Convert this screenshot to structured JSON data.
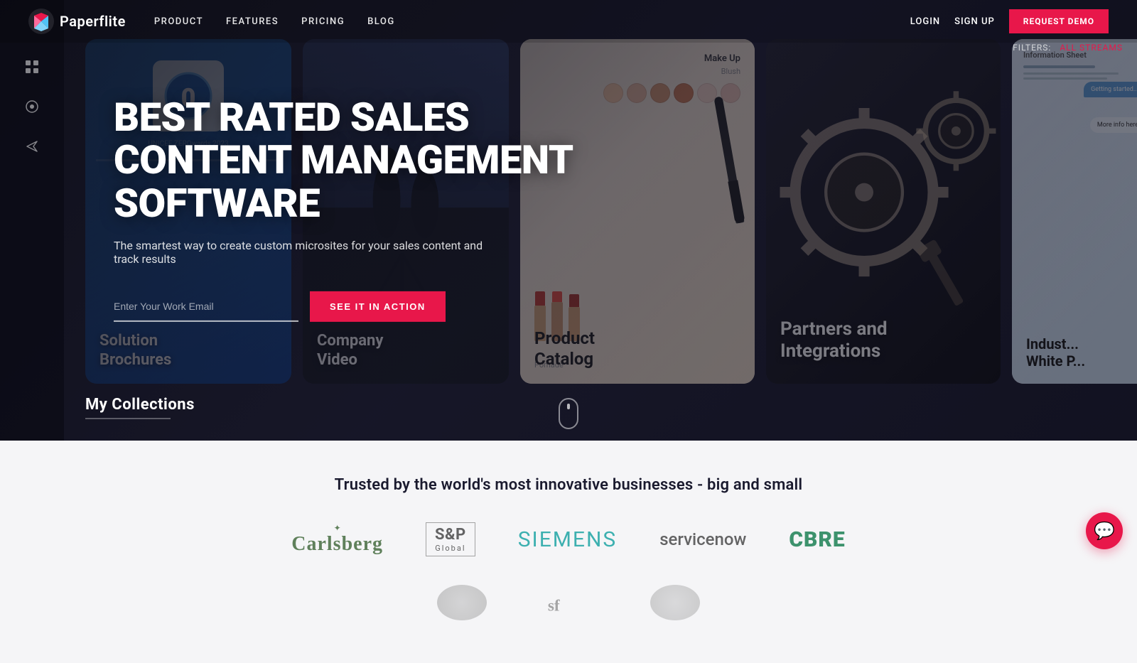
{
  "nav": {
    "logo_text": "Paperflite",
    "links": [
      {
        "label": "PRODUCT",
        "id": "product"
      },
      {
        "label": "FEATURES",
        "id": "features"
      },
      {
        "label": "PRICING",
        "id": "pricing"
      },
      {
        "label": "BLOG",
        "id": "blog"
      }
    ],
    "login": "LOGIN",
    "signup": "SIGN UP",
    "request_demo": "REQUEST DEMO"
  },
  "hero": {
    "title": "BEST RATED SALES CONTENT MANAGEMENT SOFTWARE",
    "subtitle": "The smartest way to create custom microsites for your sales content and track results",
    "email_placeholder": "Enter Your Work Email",
    "cta_button": "SEE IT IN ACTION",
    "filters_label": "FILTERS:",
    "filters_value": "ALL STREAMS",
    "my_collections": "My Collections"
  },
  "cards": [
    {
      "label": "Solution\nBrochures",
      "type": "brochure"
    },
    {
      "label": "Company\nVideo",
      "type": "video"
    },
    {
      "label": "Product\nCatalog",
      "type": "catalog"
    },
    {
      "label": "Partners and\nIntegrations",
      "type": "partners"
    },
    {
      "label": "Industry\nWhite Paper",
      "type": "whitepaper"
    }
  ],
  "trust": {
    "title": "Trusted by the world's most innovative businesses - big and small",
    "logos": [
      {
        "name": "Carlsberg",
        "type": "carlsberg"
      },
      {
        "name": "S&P Global",
        "type": "sp"
      },
      {
        "name": "SIEMENS",
        "type": "siemens"
      },
      {
        "name": "servicenow",
        "type": "servicenow"
      },
      {
        "name": "CBRE",
        "type": "cbre"
      }
    ]
  },
  "chat": {
    "icon": "💬"
  }
}
